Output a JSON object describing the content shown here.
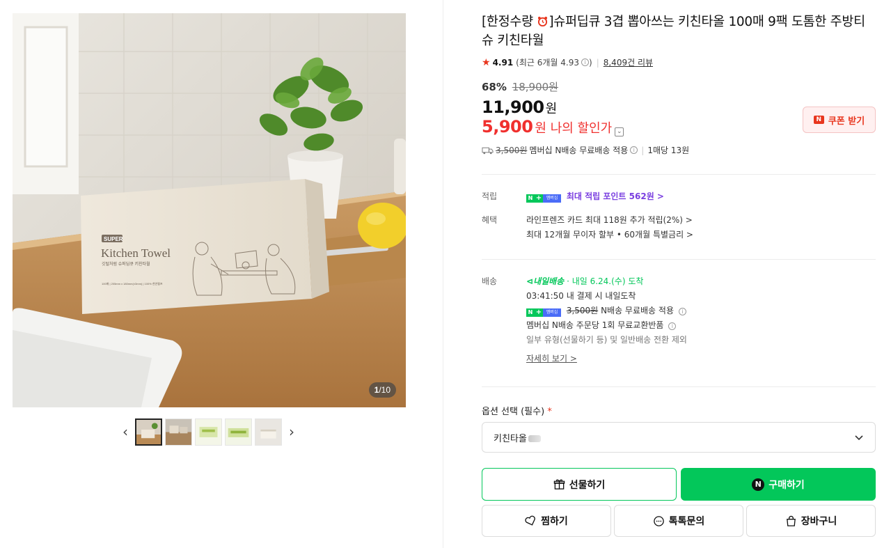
{
  "gallery": {
    "counter_current": "1",
    "counter_total": "/10",
    "box_brand": "SUPER",
    "box_title": "Kitchen Towel",
    "box_subtitle": "깃털처럼 슈퍼딥큐 키친타월",
    "box_spec": "100매 | 205mm x 180mm(±3mm) | 100% 천연펄프",
    "thumb_count": 5
  },
  "product": {
    "title_prefix": "[한정수량 ",
    "title_rest": "]슈퍼딥큐 3겹 뽑아쓰는 키친타올 100매 9팩 도톰한 주방티슈 키친타월",
    "rating_score": "4.91",
    "rating_recent": "(최근 6개월 4.93",
    "rating_recent_close": ")",
    "review_count": "8,409건 리뷰",
    "discount_rate": "68%",
    "original_price": "18,900원",
    "sale_price": "11,900",
    "sale_won": "원",
    "my_price": "5,900",
    "my_price_label": "원 나의 할인가",
    "coupon_label": "쿠폰 받기",
    "shipping_fee_strike": "3,500원",
    "shipping_text": "멤버십 N배송 무료배송 적용",
    "per_sheet": "1매당 13원"
  },
  "benefits": {
    "point_label": "적립",
    "point_text": "최대 적립 포인트 562원 >",
    "perk_label": "혜택",
    "perk_line1": "라인프렌즈 카드 최대 118원 추가 적립(2%) >",
    "perk_line2": "최대 12개월 무이자 할부 • 60개월 특별금리 >"
  },
  "delivery": {
    "label": "배송",
    "badge": "내일배송",
    "arrival": "· 내일 6.24.(수) 도착",
    "cutoff": "03:41:50  내 결제 시 내일도착",
    "fee_strike": "3,500원",
    "fee_text": "N배송 무료배송 적용",
    "exchange": "멤버십 N배송 주문당 1회 무료교환반품",
    "note": "일부 유형(선물하기 등) 및 일반배송 전환 제외",
    "more": "자세히 보기 >"
  },
  "option": {
    "label": "옵션 선택 (필수)",
    "required_mark": "*",
    "selected": "키친타올"
  },
  "actions": {
    "gift": "선물하기",
    "buy": "구매하기",
    "wish": "찜하기",
    "talk": "톡톡문의",
    "cart": "장바구니"
  },
  "colors": {
    "naver_green": "#03c75a",
    "price_red": "#f0302e",
    "point_purple": "#7a3fe0"
  }
}
